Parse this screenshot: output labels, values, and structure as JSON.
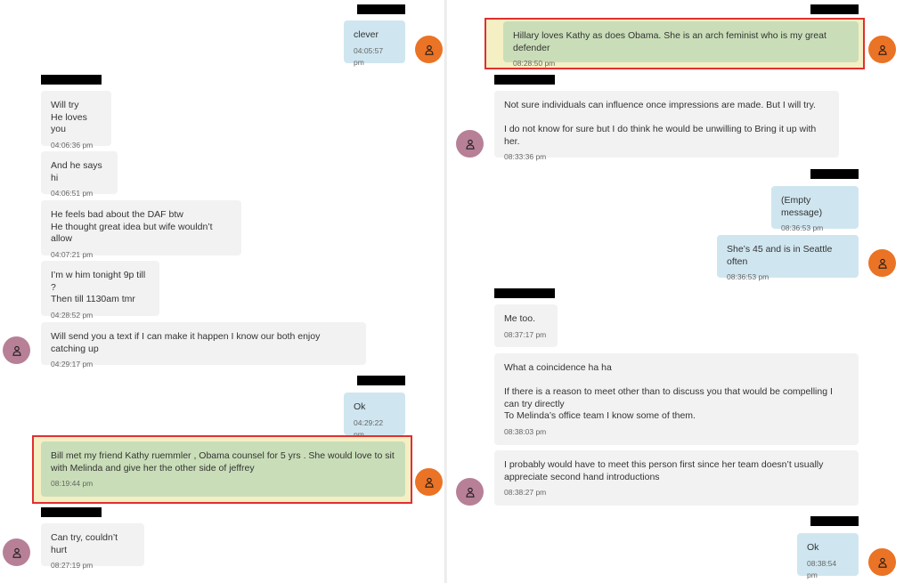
{
  "left_panel": {
    "messages": [
      {
        "text": "clever",
        "time": "04:05:57 pm"
      },
      {
        "text": "Will try\nHe loves you",
        "time": "04:06:36 pm"
      },
      {
        "text": "And he says hi",
        "time": "04:06:51 pm"
      },
      {
        "text": "He feels bad about the DAF btw\nHe thought great idea but wife wouldn’t allow",
        "time": "04:07:21 pm"
      },
      {
        "text": "I’m w him tonight 9p till ?\nThen till 1130am tmr",
        "time": "04:28:52 pm"
      },
      {
        "text": "Will send you a text if I can make it happen I know our both enjoy catching up",
        "time": "04:29:17 pm"
      },
      {
        "text": "Ok",
        "time": "04:29:22 pm"
      },
      {
        "text": "Bill met my friend Kathy ruemmler , Obama counsel for 5 yrs . She would love to sit with Melinda and give her the other side of jeffrey",
        "time": "08:19:44 pm"
      },
      {
        "text": "Can try, couldn’t hurt",
        "time": "08:27:19 pm"
      }
    ]
  },
  "right_panel": {
    "messages": [
      {
        "text": "Hillary loves Kathy as does Obama. She is an arch feminist who is my great defender",
        "time": "08:28:50 pm"
      },
      {
        "text": "Not sure individuals can influence once impressions are made. But I will try.\n\nI do not know for sure but I do think he would be unwilling to Bring it up with her.",
        "time": "08:33:36 pm"
      },
      {
        "text": "(Empty message)",
        "time": "08:36:53 pm"
      },
      {
        "text": "She’s 45 and is in Seattle often",
        "time": "08:36:53 pm"
      },
      {
        "text": "Me too.",
        "time": "08:37:17 pm"
      },
      {
        "text": "What a coincidence ha ha\n\nIf there is a reason to meet other than to discuss you that would be compelling I can try directly\nTo Melinda’s office team I know some of them.",
        "time": "08:38:03 pm"
      },
      {
        "text": "I probably would have to meet this person first since her team doesn’t usually appreciate second hand introductions",
        "time": "08:38:27 pm"
      },
      {
        "text": "Ok",
        "time": "08:38:54 pm"
      }
    ]
  },
  "icons": {
    "avatar": "person-icon",
    "redaction": "redaction-bar"
  },
  "colors": {
    "incoming_bubble": "#f2f2f2",
    "outgoing_bubble": "#cfe6f0",
    "highlighted_bubble": "#c9deb8",
    "highlight_border": "#e03030",
    "avatar_sender": "#ea7325",
    "avatar_receiver": "#b78096"
  }
}
